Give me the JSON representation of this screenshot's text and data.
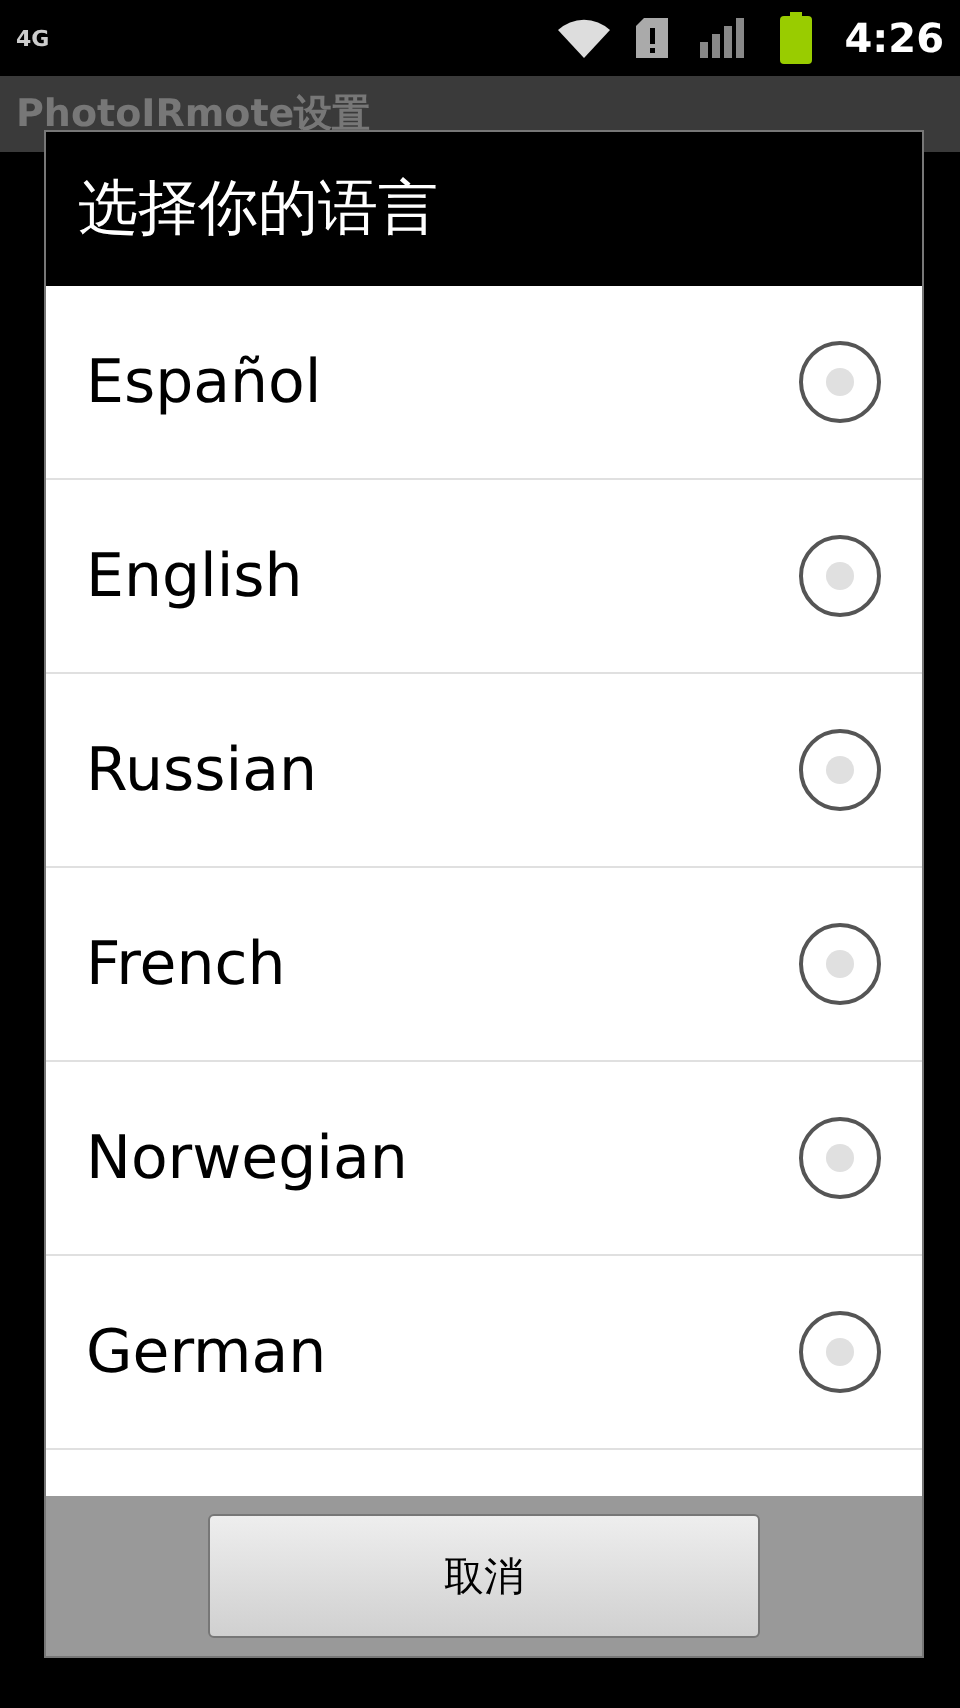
{
  "status_bar": {
    "network": "4G",
    "time": "4:26"
  },
  "app_bar": {
    "title": "PhotoIRmote设置"
  },
  "dialog": {
    "title": "选择你的语言",
    "options": [
      {
        "label": "Español",
        "selected": false
      },
      {
        "label": "English",
        "selected": false
      },
      {
        "label": "Russian",
        "selected": false
      },
      {
        "label": "French",
        "selected": false
      },
      {
        "label": "Norwegian",
        "selected": false
      },
      {
        "label": "German",
        "selected": false
      }
    ],
    "cancel_button": "取消"
  }
}
